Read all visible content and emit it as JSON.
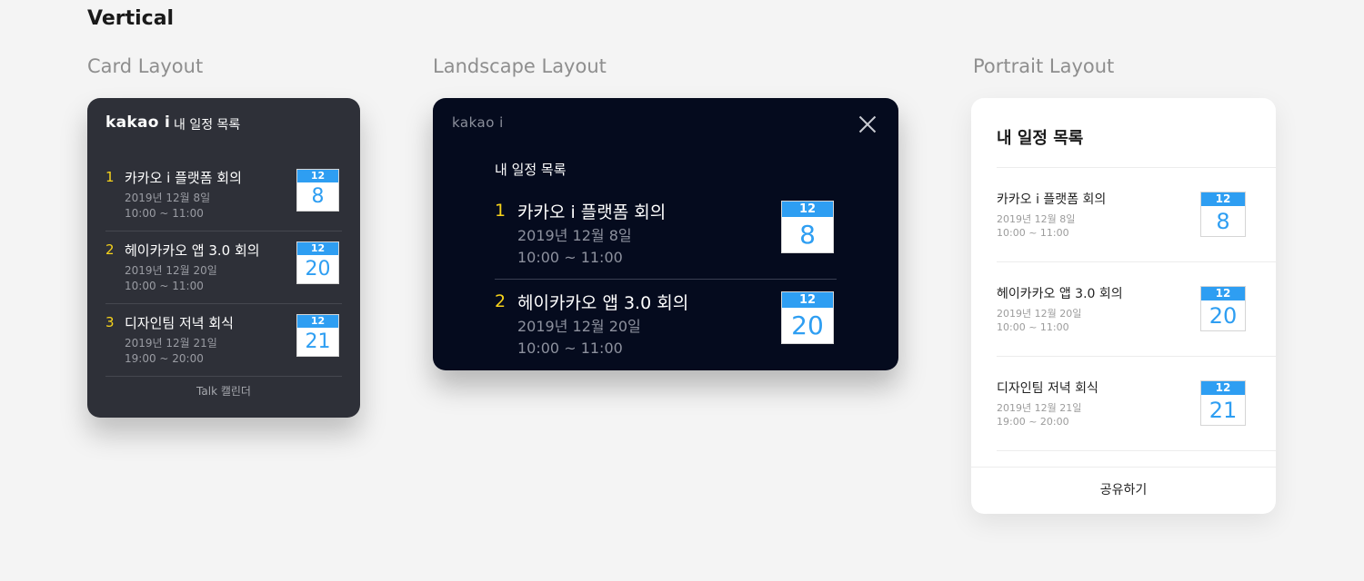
{
  "heading": "Vertical",
  "labels": {
    "card": "Card Layout",
    "landscape": "Landscape Layout",
    "portrait": "Portrait Layout"
  },
  "card": {
    "brand": "kakao i",
    "title": "내 일정 목록",
    "items": [
      {
        "num": "1",
        "name": "카카오 i 플랫폼 회의",
        "date": "2019년 12월 8일",
        "time": "10:00 ~ 11:00",
        "month": "12",
        "day": "8"
      },
      {
        "num": "2",
        "name": "헤이카카오 앱 3.0 회의",
        "date": "2019년 12월 20일",
        "time": "10:00 ~ 11:00",
        "month": "12",
        "day": "20"
      },
      {
        "num": "3",
        "name": "디자인팀 저녁 회식",
        "date": "2019년 12월 21일",
        "time": "19:00 ~ 20:00",
        "month": "12",
        "day": "21"
      }
    ],
    "footer": "Talk 캘린더"
  },
  "landscape": {
    "brand": "kakao i",
    "title": "내 일정 목록",
    "items": [
      {
        "num": "1",
        "name": "카카오 i 플랫폼 회의",
        "date": "2019년 12월 8일",
        "time": "10:00 ~ 11:00",
        "month": "12",
        "day": "8"
      },
      {
        "num": "2",
        "name": "헤이카카오 앱 3.0 회의",
        "date": "2019년 12월 20일",
        "time": "10:00 ~ 11:00",
        "month": "12",
        "day": "20"
      }
    ]
  },
  "portrait": {
    "title": "내 일정 목록",
    "items": [
      {
        "name": "카카오 i 플랫폼 회의",
        "date": "2019년 12월 8일",
        "time": "10:00 ~ 11:00",
        "month": "12",
        "day": "8"
      },
      {
        "name": "헤이카카오 앱 3.0 회의",
        "date": "2019년 12월 20일",
        "time": "10:00 ~ 11:00",
        "month": "12",
        "day": "20"
      },
      {
        "name": "디자인팀 저녁 회식",
        "date": "2019년 12월 21일",
        "time": "19:00 ~ 20:00",
        "month": "12",
        "day": "21"
      }
    ],
    "share_label": "공유하기"
  },
  "colors": {
    "accent_yellow": "#f7d31b",
    "calendar_blue": "#2e9ef2",
    "card_bg": "#2e3038",
    "landscape_bg": "#050b1e"
  }
}
